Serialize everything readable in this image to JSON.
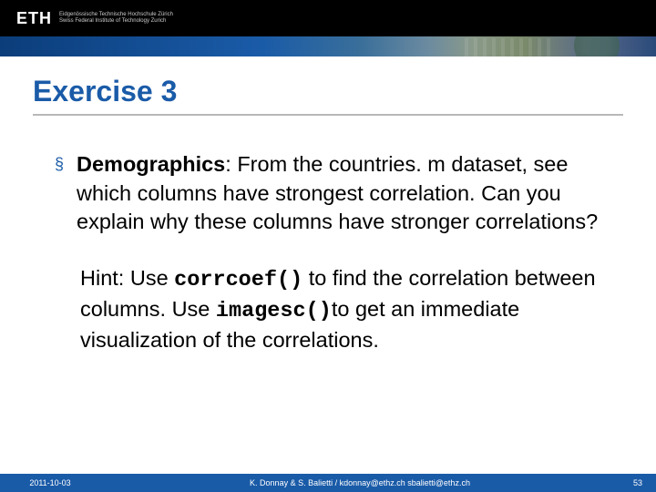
{
  "header": {
    "logo": "ETH",
    "subtitle_line1": "Eidgenössische Technische Hochschule Zürich",
    "subtitle_line2": "Swiss Federal Institute of Technology Zurich"
  },
  "title": "Exercise 3",
  "body": {
    "bullet_label": "Demographics",
    "bullet_text": ": From the countries. m dataset, see which columns have strongest correlation. Can you explain why these columns have stronger correlations?",
    "hint_prefix": "Hint: Use ",
    "code1": "corrcoef()",
    "hint_mid": " to find the correlation between columns. Use ",
    "code2": "imagesc()",
    "hint_suffix": "to get an immediate visualization of the correlations."
  },
  "footer": {
    "date": "2011-10-03",
    "credits": "K. Donnay & S. Balietti / kdonnay@ethz.ch sbalietti@ethz.ch",
    "page": "53"
  }
}
